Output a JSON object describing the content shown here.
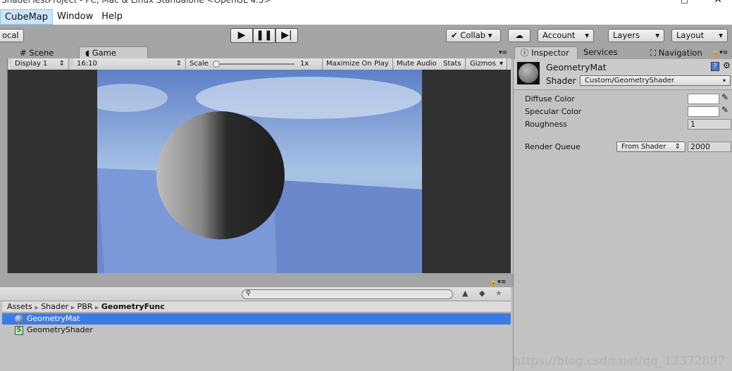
{
  "window_title": "ShaderTestProject - PC, Mac & Linux Standalone <OpenGL 4.5>",
  "menu": [
    "CubeMap",
    "Window",
    "Help"
  ],
  "toolbar": {
    "local": "ocal",
    "collab": "Collab",
    "account": "Account",
    "layers": "Layers",
    "layout": "Layout"
  },
  "tabs": {
    "scene": "Scene",
    "game": "Game",
    "inspector": "Inspector",
    "services": "Services",
    "navigation": "Navigation"
  },
  "game_toolbar": {
    "display": "Display 1",
    "aspect": "16:10",
    "scale_label": "Scale",
    "scale_value": "1x",
    "maximize": "Maximize On Play",
    "mute": "Mute Audio",
    "stats": "Stats",
    "gizmos": "Gizmos"
  },
  "inspector": {
    "name": "GeometryMat",
    "shader_label": "Shader",
    "shader": "Custom/GeometryShader",
    "props": [
      {
        "label": "Diffuse Color"
      },
      {
        "label": "Specular Color"
      },
      {
        "label": "Roughness",
        "value": "1"
      }
    ],
    "render_queue": {
      "label": "Render Queue",
      "mode": "From Shader",
      "value": "2000"
    }
  },
  "project": {
    "breadcrumb": [
      "Assets",
      "Shader",
      "PBR",
      "GeometryFunc"
    ],
    "items": [
      {
        "name": "GeometryMat",
        "selected": true
      },
      {
        "name": "GeometryShader"
      }
    ]
  },
  "colors": {
    "selection": "#3d7be4",
    "toolbar": "#a5a5a5",
    "panel": "#c2c2c2"
  },
  "watermark": "https://blog.csdn.net/qq_12372897"
}
